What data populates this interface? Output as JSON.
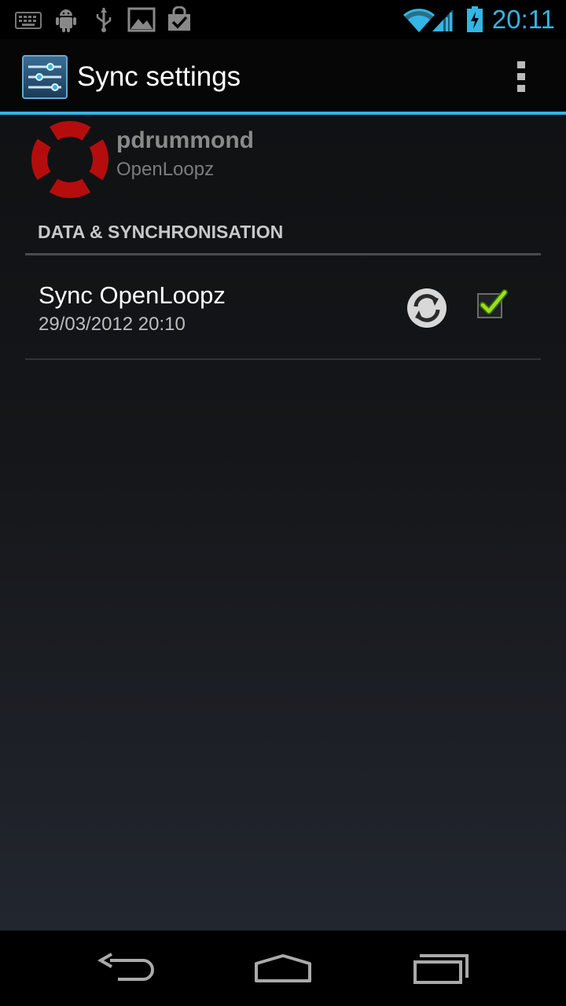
{
  "status_bar": {
    "time": "20:11",
    "time_color": "#33b5e5",
    "icons": [
      "keyboard-icon",
      "android-debug-icon",
      "usb-icon",
      "image-icon",
      "market-update-icon",
      "wifi-icon",
      "signal-icon",
      "battery-charging-icon"
    ]
  },
  "action_bar": {
    "title": "Sync settings",
    "accent_color": "#33b5e5"
  },
  "account": {
    "name": "pdrummond",
    "type": "OpenLoopz"
  },
  "section": {
    "header": "DATA & SYNCHRONISATION"
  },
  "sync_item": {
    "title": "Sync OpenLoopz",
    "last_synced": "29/03/2012 20:10",
    "checked": true
  },
  "nav_bar": {
    "buttons": [
      "back-icon",
      "home-icon",
      "recent-apps-icon"
    ]
  }
}
